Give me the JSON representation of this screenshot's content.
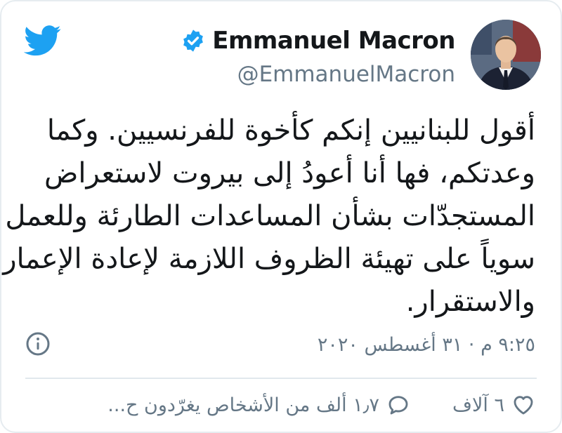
{
  "author": {
    "display_name": "Emmanuel Macron",
    "handle": "@EmmanuelMacron",
    "verified": true,
    "avatar": "profile-photo"
  },
  "tweet": {
    "lines": [
      "أقول للبنانيين إنكم كأخوة للفرنسيين. وكما",
      "وعدتكم، فها أنا أعودُ إلى بيروت لاستعراض",
      "المستجدّات بشأن المساعدات الطارئة وللعمل",
      "سوياً على تهيئة الظروف اللازمة لإعادة الإعمار",
      "والاستقرار."
    ],
    "timestamp": "٩:٢٥ م · ٣١ أغسطس ٢٠٢٠"
  },
  "actions": {
    "likes": "٦ آلاف",
    "replies": "١٫٧ ألف من الأشخاص يغرّدون ح..."
  },
  "icons": {
    "brand": "twitter-bird-icon",
    "verified": "verified-badge-icon",
    "info": "info-icon",
    "like": "heart-icon",
    "reply": "reply-bubble-icon"
  },
  "colors": {
    "brand_blue": "#1da1f2",
    "text": "#14171a",
    "secondary_text": "#657786",
    "divider": "#e1e8ed"
  }
}
